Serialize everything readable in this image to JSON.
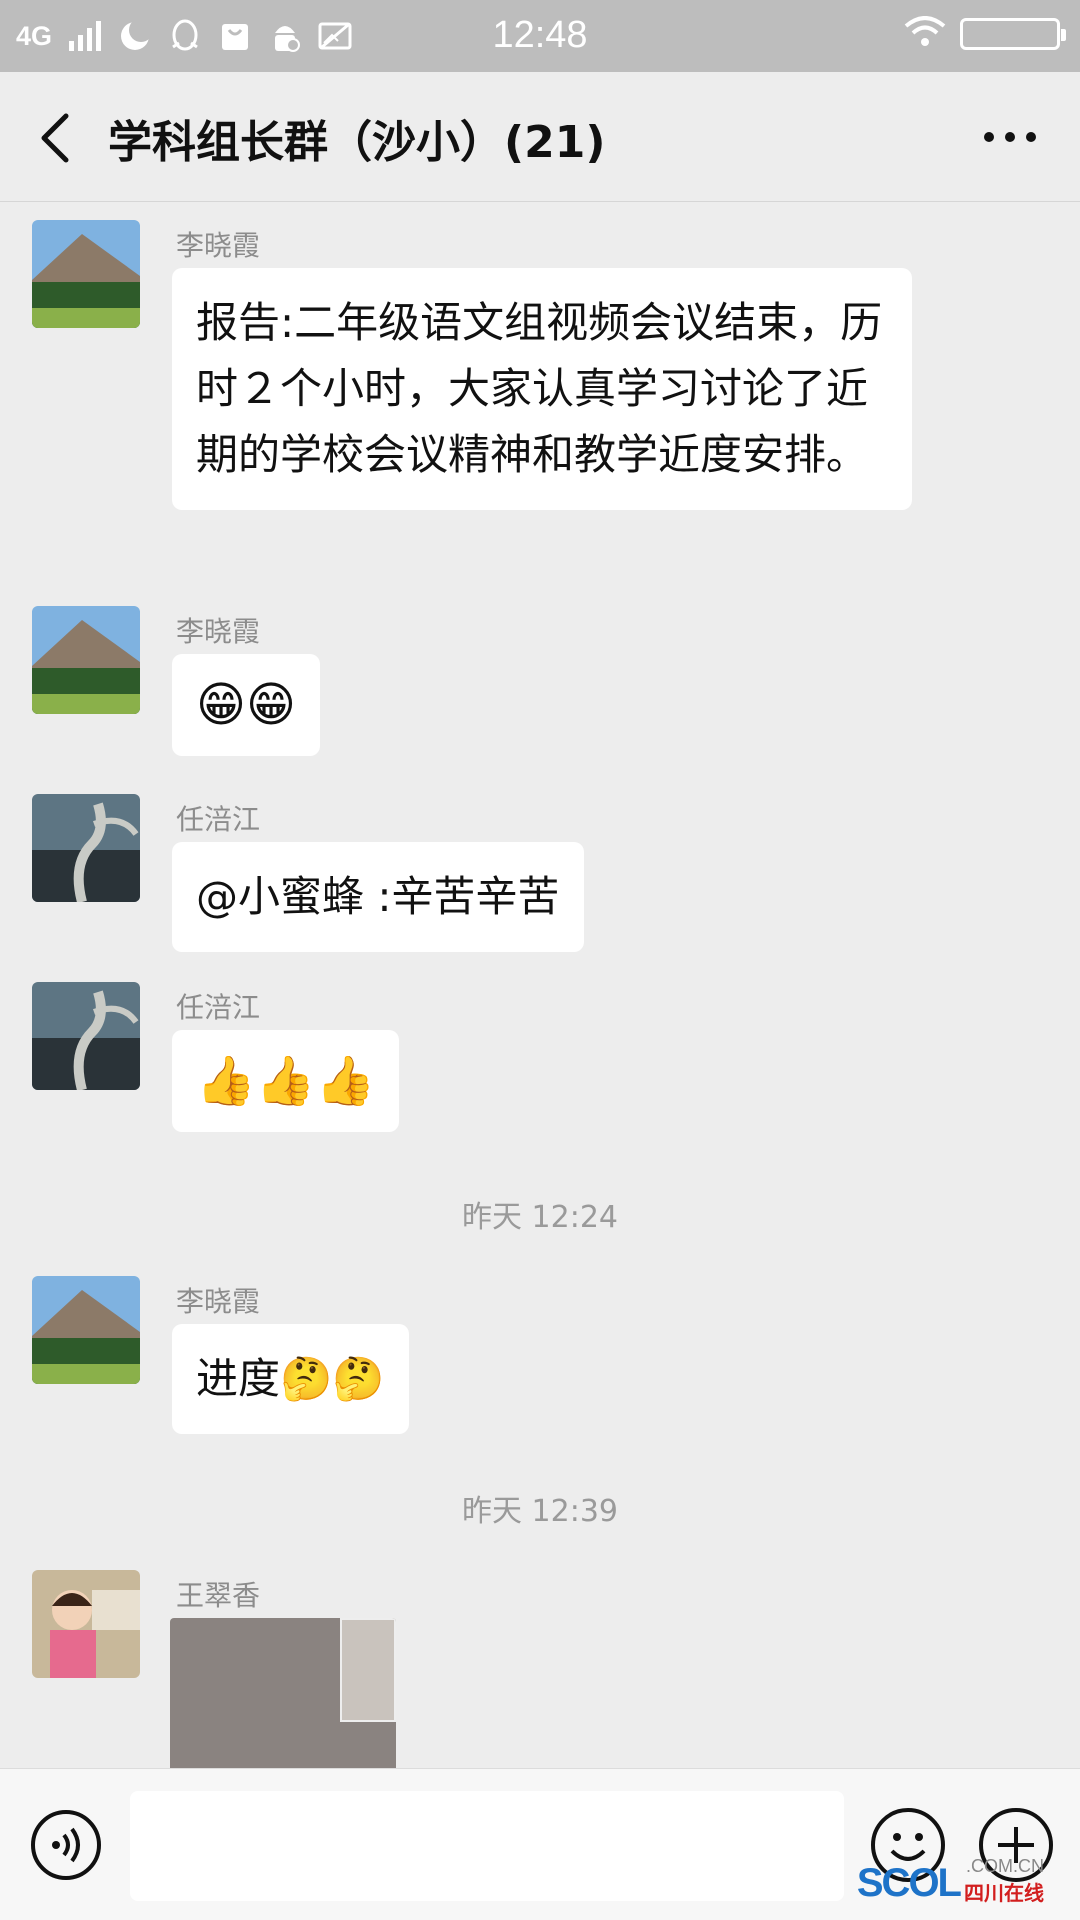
{
  "status_bar": {
    "network": "4G",
    "time": "12:48",
    "icons": [
      "signal-icon",
      "moon-icon",
      "penguin-icon",
      "bag-icon",
      "android-icon",
      "no-image-icon",
      "wifi-icon",
      "battery-icon"
    ]
  },
  "header": {
    "title": "学科组长群（沙小）(21)"
  },
  "messages": [
    {
      "sender": "李晓霞",
      "type": "text",
      "text": "报告:二年级语文组视频会议结束，历时２个小时，大家认真学习讨论了近期的学校会议精神和教学近度安排。"
    },
    {
      "sender": "李晓霞",
      "type": "emoji",
      "text": "😁😁"
    },
    {
      "sender": "任涪江",
      "type": "text",
      "text": "@小蜜蜂 :辛苦辛苦"
    },
    {
      "sender": "任涪江",
      "type": "emoji",
      "text": "👍👍👍"
    },
    {
      "type": "timestamp",
      "text": "昨天 12:24"
    },
    {
      "sender": "李晓霞",
      "type": "text",
      "text": "进度🤔🤔"
    },
    {
      "type": "timestamp",
      "text": "昨天 12:39"
    },
    {
      "sender": "王翠香",
      "type": "image",
      "text": ""
    }
  ],
  "input_bar": {
    "placeholder": ""
  },
  "watermark": {
    "logo": "SCOL",
    "domain": ".COM.CN",
    "name": "四川在线"
  },
  "colors": {
    "background": "#ededed",
    "status_bar": "#bdbdbd",
    "bubble": "#ffffff",
    "sender": "#8c8c8c"
  }
}
